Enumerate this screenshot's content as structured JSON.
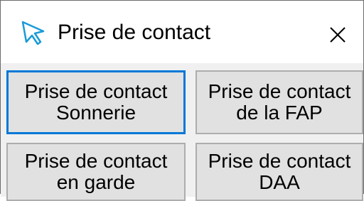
{
  "window": {
    "title": "Prise de contact",
    "title_icon": "cursor-arrow-icon",
    "close_icon": "close-icon"
  },
  "buttons": [
    {
      "line1": "Prise de contact",
      "line2": "Sonnerie",
      "focused": true
    },
    {
      "line1": "Prise de contact",
      "line2": "de la FAP",
      "focused": false
    },
    {
      "line1": "Prise de contact",
      "line2": "en garde",
      "focused": false
    },
    {
      "line1": "Prise de contact",
      "line2": "DAA",
      "focused": false
    }
  ],
  "colors": {
    "focus_border": "#0078d7",
    "button_face": "#e1e1e1",
    "button_border": "#adadad",
    "panel_background": "#f0f0f0",
    "title_icon": "#1a9bd7"
  }
}
